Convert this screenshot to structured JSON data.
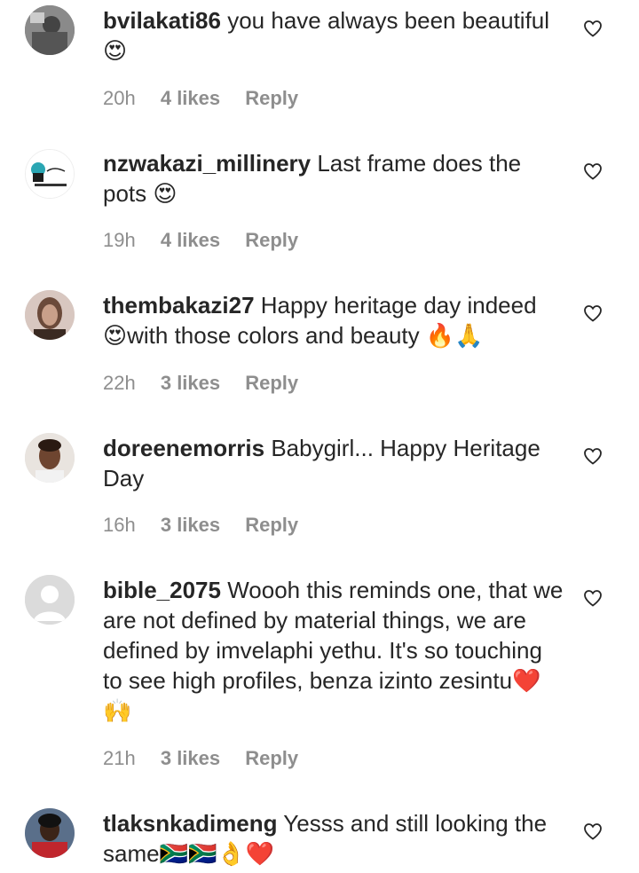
{
  "comments": [
    {
      "username": "bvilakati86",
      "text": "you have always been beautiful 😍",
      "time": "20h",
      "likes": "4 likes",
      "reply": "Reply",
      "avatar": "photo-avatar"
    },
    {
      "username": "nzwakazi_millinery",
      "text": "Last frame does the pots 😍",
      "time": "19h",
      "likes": "4 likes",
      "reply": "Reply",
      "avatar": "logo-avatar"
    },
    {
      "username": "thembakazi27",
      "text": "Happy heritage day indeed 😍with those colors and beauty 🔥🙏",
      "time": "22h",
      "likes": "3 likes",
      "reply": "Reply",
      "avatar": "photo-avatar"
    },
    {
      "username": "doreenemorris",
      "text": "Babygirl... Happy Heritage Day",
      "time": "16h",
      "likes": "3 likes",
      "reply": "Reply",
      "avatar": "photo-avatar"
    },
    {
      "username": "bible_2075",
      "text": "Woooh this reminds one, that we are not defined by material things, we are defined by imvelaphi yethu. It's so touching to see high profiles, benza izinto zesintu❤️🙌",
      "time": "21h",
      "likes": "3 likes",
      "reply": "Reply",
      "avatar": "default-avatar"
    },
    {
      "username": "tlaksnkadimeng",
      "text": "Yesss and still looking the same🇿🇦🇿🇦👌❤️",
      "time": "",
      "likes": "",
      "reply": "",
      "avatar": "photo-avatar"
    }
  ],
  "colors": {
    "text": "#262626",
    "meta": "#8e8e8e",
    "heart_outline": "#262626"
  },
  "icons": {
    "like": "heart-outline-icon"
  }
}
